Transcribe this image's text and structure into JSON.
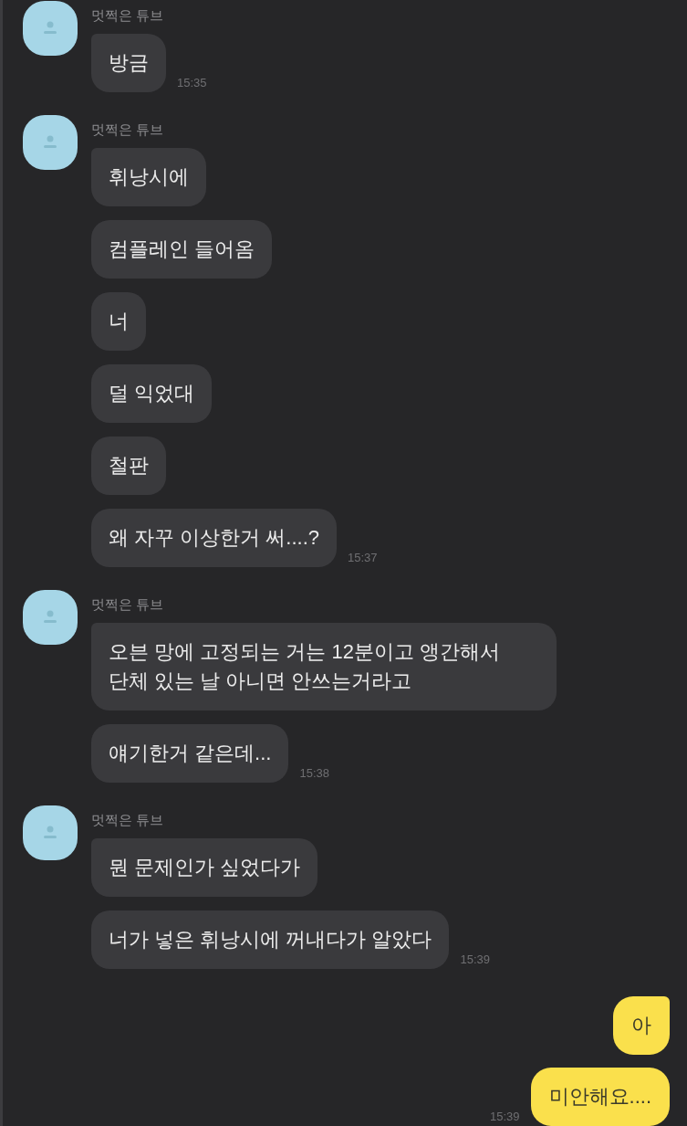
{
  "conversation": [
    {
      "kind": "received",
      "sender": "멋쩍은 튜브",
      "messages": [
        "방금"
      ],
      "time": "15:35"
    },
    {
      "kind": "received",
      "sender": "멋쩍은 튜브",
      "messages": [
        "휘낭시에",
        "컴플레인 들어옴",
        "너",
        "덜 익었대",
        "철판",
        "왜 자꾸 이상한거 써....?"
      ],
      "time": "15:37"
    },
    {
      "kind": "received",
      "sender": "멋쩍은 튜브",
      "messages": [
        "오븐 망에 고정되는 거는 12분이고 앵간해서 단체 있는 날 아니면 안쓰는거라고",
        "얘기한거 같은데..."
      ],
      "time": "15:38"
    },
    {
      "kind": "received",
      "sender": "멋쩍은 튜브",
      "messages": [
        "뭔 문제인가 싶었다가",
        "너가 넣은 휘낭시에 꺼내다가 알았다"
      ],
      "time": "15:39"
    },
    {
      "kind": "sent",
      "messages": [
        "아",
        "미안해요...."
      ],
      "time": "15:39"
    }
  ]
}
